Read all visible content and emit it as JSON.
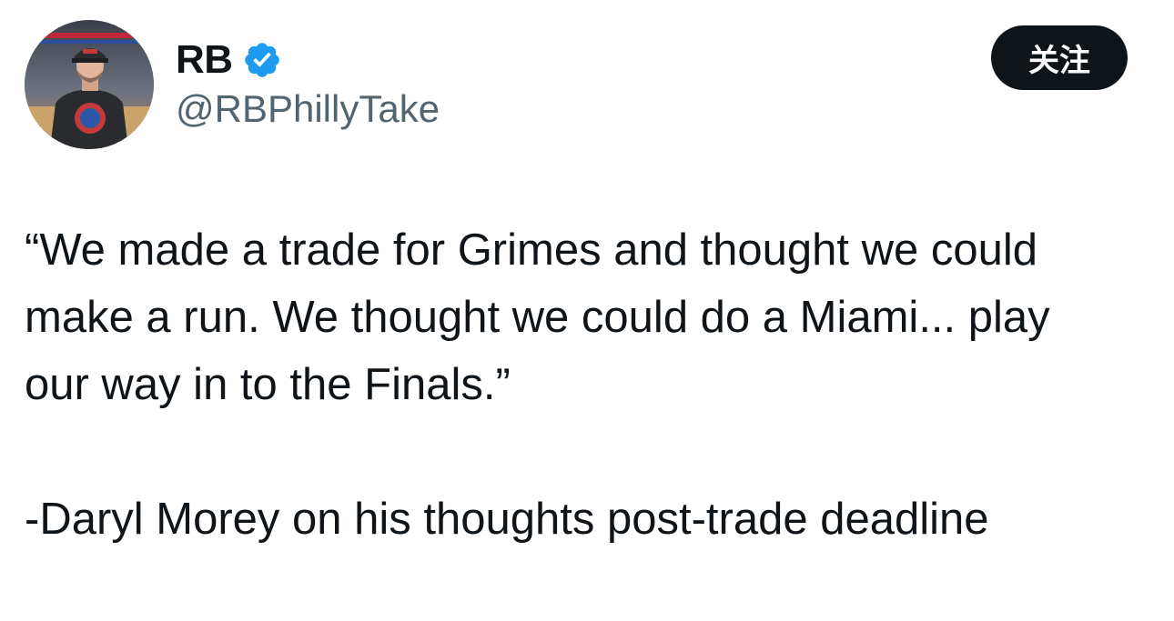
{
  "author": {
    "display_name": "RB",
    "handle": "@RBPhillyTake",
    "verified": true,
    "verified_icon": "verified-badge-icon",
    "verified_color": "#1d9bf0"
  },
  "follow_button": {
    "label": "关注"
  },
  "tweet": {
    "quote_lines": [
      "“We made a trade for Grimes and thought we could",
      "make a run. We thought we could do a Miami... play",
      "our way in to the Finals.”"
    ],
    "attribution": "-Daryl Morey on his thoughts post-trade deadline"
  },
  "colors": {
    "text": "#0f1419",
    "secondary_text": "#536471",
    "button_bg": "#0f1419",
    "button_text": "#ffffff"
  }
}
